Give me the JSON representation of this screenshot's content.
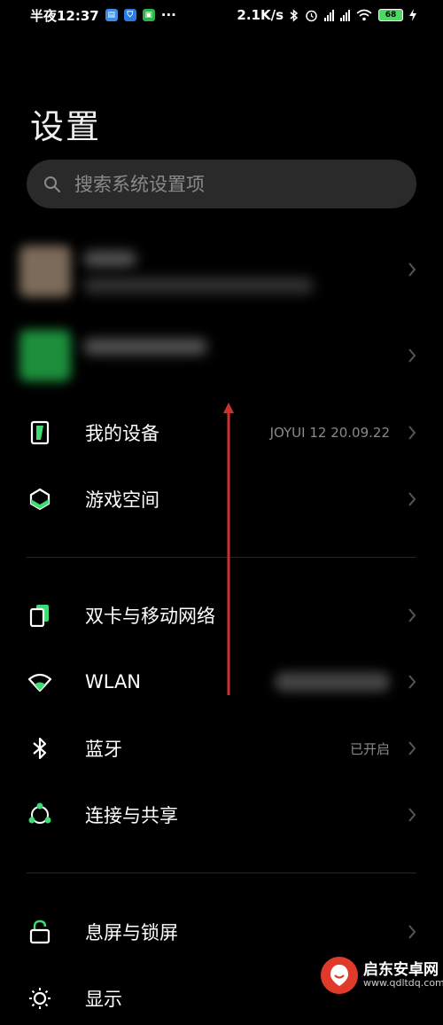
{
  "status_bar": {
    "time": "半夜12:37",
    "more": "···",
    "net_speed": "2.1K/s",
    "battery_level": "68",
    "app_badges": [
      {
        "icon": "calendar-icon",
        "color": "#3a8ee6"
      },
      {
        "icon": "shield-app-icon",
        "color": "#2a7be4"
      },
      {
        "icon": "wechat-app-icon",
        "color": "#2fb24a"
      }
    ]
  },
  "header": {
    "title": "设置"
  },
  "search": {
    "placeholder": "搜索系统设置项"
  },
  "settings": {
    "my_device": {
      "label": "我的设备",
      "value": "JOYUI 12 20.09.22"
    },
    "game_space": {
      "label": "游戏空间"
    },
    "dual_sim": {
      "label": "双卡与移动网络"
    },
    "wlan": {
      "label": "WLAN"
    },
    "bluetooth": {
      "label": "蓝牙",
      "value": "已开启"
    },
    "connection_share": {
      "label": "连接与共享"
    },
    "lock_screen": {
      "label": "息屏与锁屏"
    },
    "display": {
      "label": "显示"
    }
  },
  "watermark": {
    "title": "启东安卓网",
    "url": "www.qdltdq.com"
  },
  "colors": {
    "accent": "#3ddc74",
    "annotation_arrow": "#d0302c",
    "background": "#000000"
  }
}
